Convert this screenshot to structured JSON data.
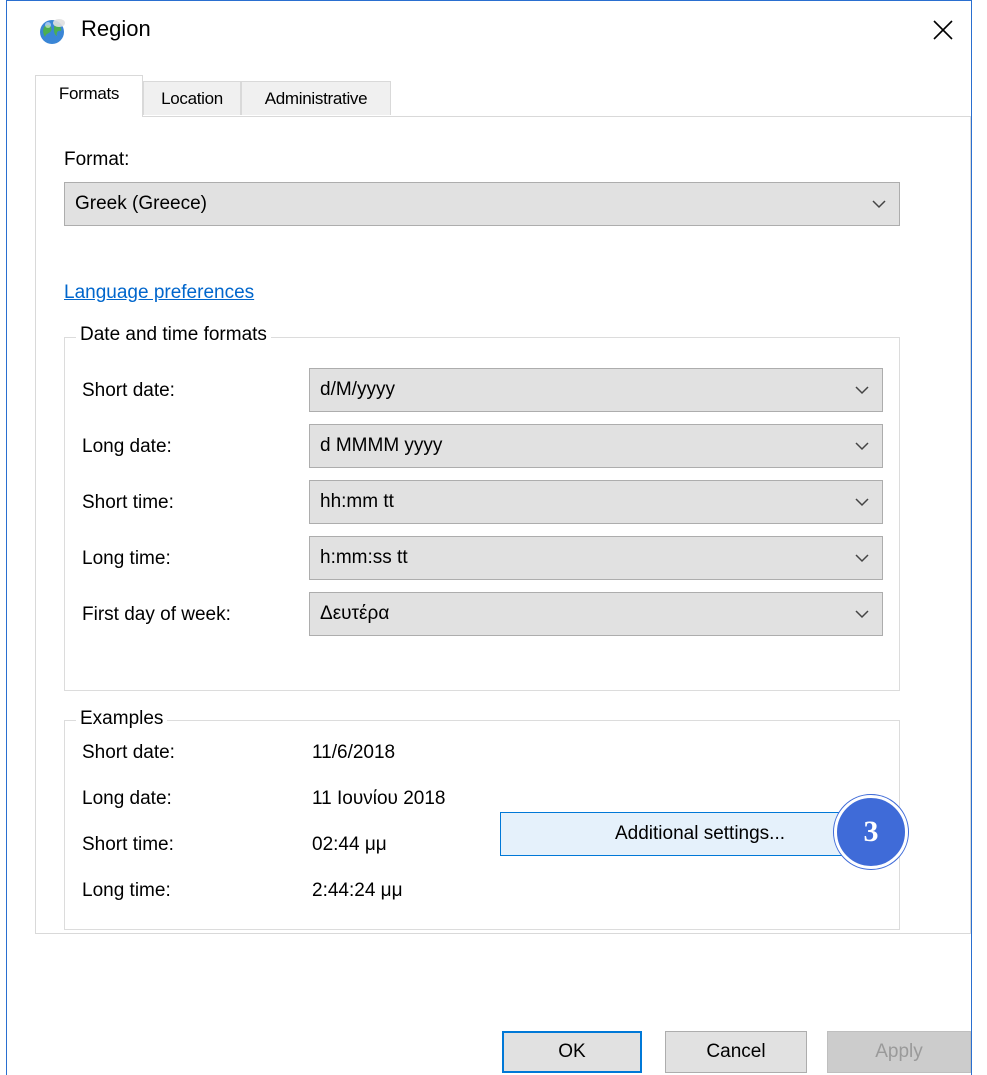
{
  "window": {
    "title": "Region"
  },
  "tabs": [
    {
      "label": "Formats",
      "active": true
    },
    {
      "label": "Location",
      "active": false
    },
    {
      "label": "Administrative",
      "active": false
    }
  ],
  "format": {
    "label": "Format:",
    "value": "Greek (Greece)"
  },
  "language_link": "Language preferences",
  "date_time_formats": {
    "title": "Date and time formats",
    "rows": [
      {
        "label": "Short date:",
        "value": "d/M/yyyy"
      },
      {
        "label": "Long date:",
        "value": "d MMMM yyyy"
      },
      {
        "label": "Short time:",
        "value": "hh:mm tt"
      },
      {
        "label": "Long time:",
        "value": "h:mm:ss tt"
      },
      {
        "label": "First day of week:",
        "value": "Δευτέρα"
      }
    ]
  },
  "examples": {
    "title": "Examples",
    "rows": [
      {
        "label": "Short date:",
        "value": "11/6/2018"
      },
      {
        "label": "Long date:",
        "value": "11 Ιουνίου 2018"
      },
      {
        "label": "Short time:",
        "value": "02:44 μμ"
      },
      {
        "label": "Long time:",
        "value": "2:44:24 μμ"
      }
    ]
  },
  "additional_settings_label": "Additional settings...",
  "step_badge": "3",
  "footer": {
    "ok_label": "OK",
    "cancel_label": "Cancel",
    "apply_label": "Apply"
  },
  "colors": {
    "accent": "#0078d7",
    "link": "#0066cc",
    "badge": "#3f6bd8"
  },
  "icons": {
    "title": "globe-icon",
    "close": "close-icon",
    "dropdown": "chevron-down-icon"
  }
}
